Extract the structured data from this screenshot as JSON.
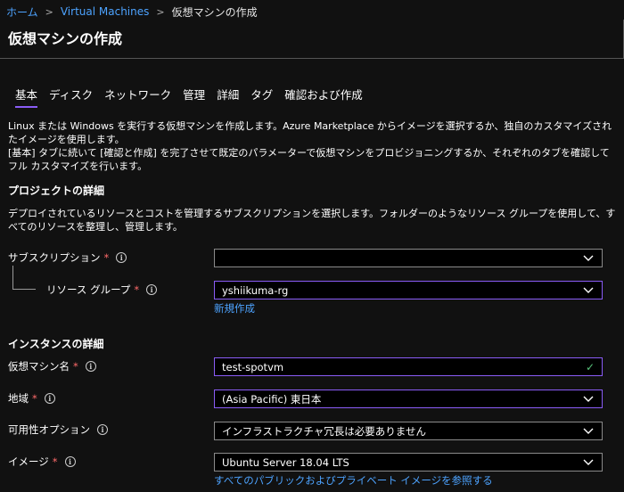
{
  "breadcrumb": {
    "home": "ホーム",
    "separator": ">",
    "vm": "Virtual Machines",
    "current": "仮想マシンの作成"
  },
  "page_title": "仮想マシンの作成",
  "tabs": [
    {
      "label": "基本",
      "active": true
    },
    {
      "label": "ディスク"
    },
    {
      "label": "ネットワーク"
    },
    {
      "label": "管理"
    },
    {
      "label": "詳細"
    },
    {
      "label": "タグ"
    },
    {
      "label": "確認および作成"
    }
  ],
  "intro": {
    "p1": "Linux または Windows を実行する仮想マシンを作成します。Azure Marketplace からイメージを選択するか、独自のカスタマイズされたイメージを使用します。",
    "p2": "[基本] タブに続いて [確認と作成] を完了させて既定のパラメーターで仮想マシンをプロビジョニングするか、それぞれのタブを確認してフル カスタマイズを行います。"
  },
  "project": {
    "title": "プロジェクトの詳細",
    "desc": "デプロイされているリソースとコストを管理するサブスクリプションを選択します。フォルダーのようなリソース グループを使用して、すべてのリソースを整理し、管理します。",
    "subscription_label": "サブスクリプション",
    "subscription_value": "",
    "resource_group_label": "リソース グループ",
    "resource_group_value": "yshiikuma-rg",
    "create_new": "新規作成"
  },
  "instance": {
    "title": "インスタンスの詳細",
    "vm_name_label": "仮想マシン名",
    "vm_name_value": "test-spotvm",
    "region_label": "地域",
    "region_value": "(Asia Pacific) 東日本",
    "availability_label": "可用性オプション",
    "availability_value": "インフラストラクチャ冗長は必要ありません",
    "image_label": "イメージ",
    "image_value": "Ubuntu Server 18.04 LTS",
    "browse_images": "すべてのパブリックおよびプライベート イメージを参照する"
  },
  "required_marker": "*",
  "info_glyph": "i",
  "icons": {
    "dropdown": "chevron-down-icon",
    "valid": "checkmark-icon",
    "info": "info-icon"
  },
  "colors": {
    "accent": "#8a5cf6",
    "link": "#4da3ff",
    "required": "#ff6b6b",
    "valid": "#57c17a",
    "background": "#111111"
  }
}
